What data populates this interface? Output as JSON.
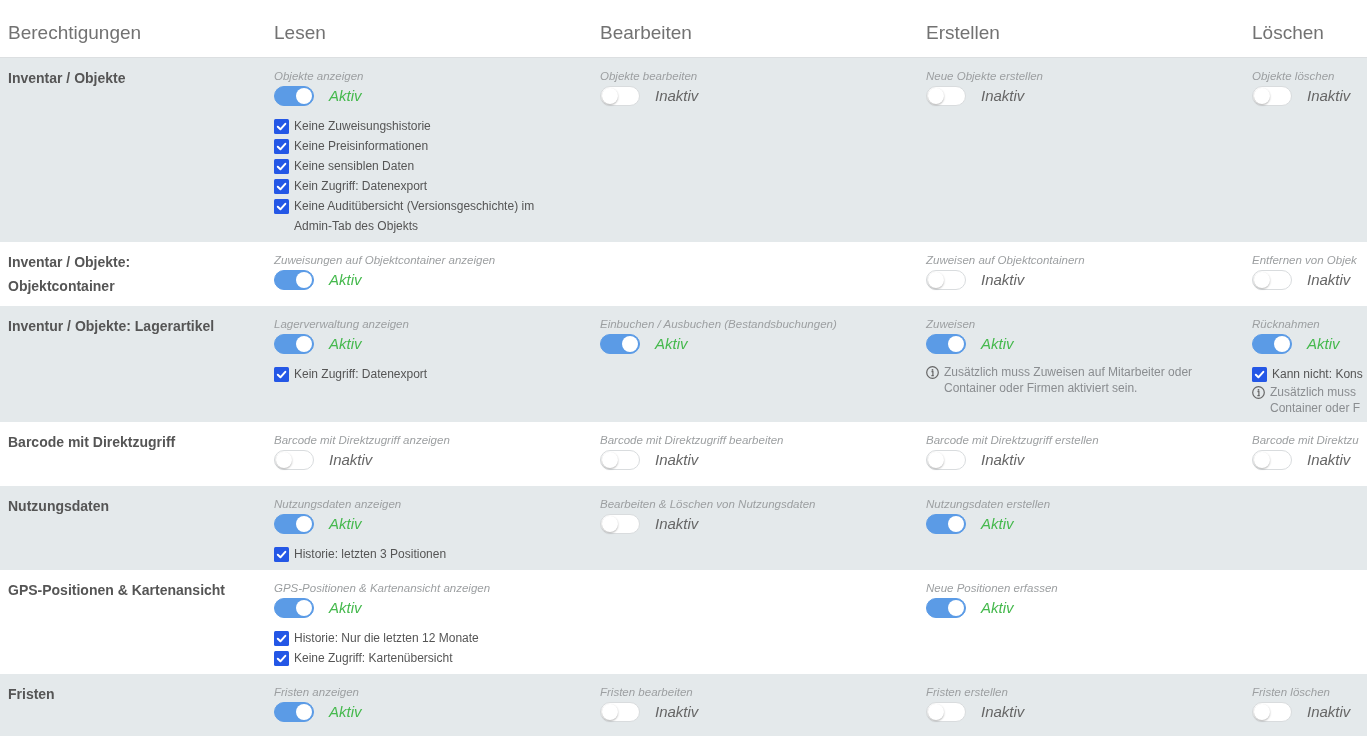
{
  "columns": [
    "Berechtigungen",
    "Lesen",
    "Bearbeiten",
    "Erstellen",
    "Löschen"
  ],
  "rows": [
    {
      "label": "Inventar / Objekte",
      "cells": [
        {
          "caption": "Objekte anzeigen",
          "on": true,
          "status": "Aktiv",
          "options": [
            {
              "label": "Keine Zuweisungshistorie",
              "checked": true
            },
            {
              "label": "Keine Preisinformationen",
              "checked": true
            },
            {
              "label": "Keine sensiblen Daten",
              "checked": true
            },
            {
              "label": "Kein Zugriff: Datenexport",
              "checked": true
            },
            {
              "label": "Keine Auditübersicht (Versionsgeschichte) im Admin-Tab des Objekts",
              "checked": true
            }
          ]
        },
        {
          "caption": "Objekte bearbeiten",
          "on": false,
          "status": "Inaktiv"
        },
        {
          "caption": "Neue Objekte erstellen",
          "on": false,
          "status": "Inaktiv"
        },
        {
          "caption": "Objekte löschen",
          "on": false,
          "status": "Inaktiv"
        }
      ]
    },
    {
      "label": "Inventar / Objekte: Objektcontainer",
      "cells": [
        {
          "caption": "Zuweisungen auf Objektcontainer anzeigen",
          "on": true,
          "status": "Aktiv"
        },
        null,
        {
          "caption": "Zuweisen auf Objektcontainern",
          "on": false,
          "status": "Inaktiv"
        },
        {
          "caption": "Entfernen von Objek",
          "on": false,
          "status": "Inaktiv"
        }
      ]
    },
    {
      "label": "Inventur / Objekte: Lagerartikel",
      "cells": [
        {
          "caption": "Lagerverwaltung anzeigen",
          "on": true,
          "status": "Aktiv",
          "options": [
            {
              "label": "Kein Zugriff: Datenexport",
              "checked": true
            }
          ]
        },
        {
          "caption": "Einbuchen / Ausbuchen (Bestandsbuchungen)",
          "on": true,
          "status": "Aktiv"
        },
        {
          "caption": "Zuweisen",
          "on": true,
          "status": "Aktiv",
          "note": "Zusätzlich muss Zuweisen auf Mitarbeiter oder Container oder Firmen aktiviert sein."
        },
        {
          "caption": "Rücknahmen",
          "on": true,
          "status": "Aktiv",
          "options": [
            {
              "label": "Kann nicht: Kons",
              "checked": true
            }
          ],
          "note": "Zusätzlich muss Container oder F"
        }
      ]
    },
    {
      "label": "Barcode mit Direktzugriff",
      "cells": [
        {
          "caption": "Barcode mit Direktzugriff anzeigen",
          "on": false,
          "status": "Inaktiv"
        },
        {
          "caption": "Barcode mit Direktzugriff bearbeiten",
          "on": false,
          "status": "Inaktiv"
        },
        {
          "caption": "Barcode mit Direktzugriff erstellen",
          "on": false,
          "status": "Inaktiv"
        },
        {
          "caption": "Barcode mit Direktzu",
          "on": false,
          "status": "Inaktiv"
        }
      ]
    },
    {
      "label": "Nutzungsdaten",
      "cells": [
        {
          "caption": "Nutzungsdaten anzeigen",
          "on": true,
          "status": "Aktiv",
          "options": [
            {
              "label": "Historie: letzten 3 Positionen",
              "checked": true
            }
          ]
        },
        {
          "caption": "Bearbeiten & Löschen von Nutzungsdaten",
          "on": false,
          "status": "Inaktiv"
        },
        {
          "caption": "Nutzungsdaten erstellen",
          "on": true,
          "status": "Aktiv"
        },
        null
      ]
    },
    {
      "label": "GPS-Positionen & Kartenansicht",
      "cells": [
        {
          "caption": "GPS-Positionen & Kartenansicht anzeigen",
          "on": true,
          "status": "Aktiv",
          "options": [
            {
              "label": "Historie: Nur die letzten 12 Monate",
              "checked": true
            },
            {
              "label": "Keine Zugriff: Kartenübersicht",
              "checked": true
            }
          ]
        },
        null,
        {
          "caption": "Neue Positionen erfassen",
          "on": true,
          "status": "Aktiv"
        },
        null
      ]
    },
    {
      "label": "Fristen",
      "cells": [
        {
          "caption": "Fristen anzeigen",
          "on": true,
          "status": "Aktiv"
        },
        {
          "caption": "Fristen bearbeiten",
          "on": false,
          "status": "Inaktiv"
        },
        {
          "caption": "Fristen erstellen",
          "on": false,
          "status": "Inaktiv"
        },
        {
          "caption": "Fristen löschen",
          "on": false,
          "status": "Inaktiv"
        }
      ]
    }
  ]
}
